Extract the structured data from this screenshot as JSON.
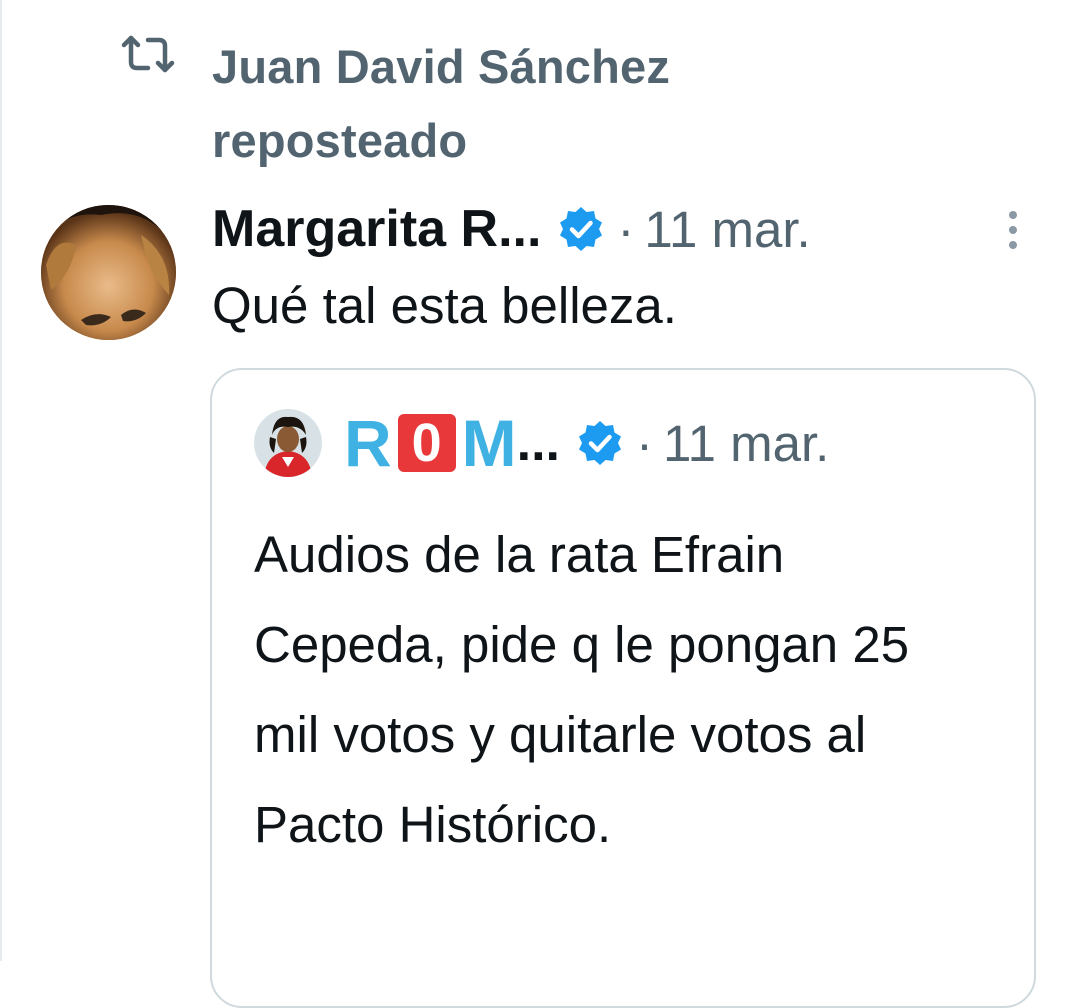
{
  "repost": {
    "icon": "repost-icon",
    "text": "Juan David Sánchez reposteado"
  },
  "tweet": {
    "author_name": "Margarita R...",
    "verified": true,
    "separator": "·",
    "date": "11 mar.",
    "text": "Qué tal esta belleza.",
    "more_icon": "more-vertical-icon"
  },
  "quote": {
    "author_letters": [
      "R",
      "0",
      "M"
    ],
    "author_ellipsis": "...",
    "verified": true,
    "separator": "·",
    "date": "11 mar.",
    "text": "Audios de la rata Efrain Cepeda, pide q le pongan 25 mil votos y quitarle votos al Pacto Histórico."
  },
  "colors": {
    "name_text": "#0f1419",
    "muted_text": "#536471",
    "verified_blue": "#1d9bf0",
    "border": "#cfd9de",
    "rom_cyan": "#3fb2e3",
    "rom_red": "#e8383a"
  }
}
